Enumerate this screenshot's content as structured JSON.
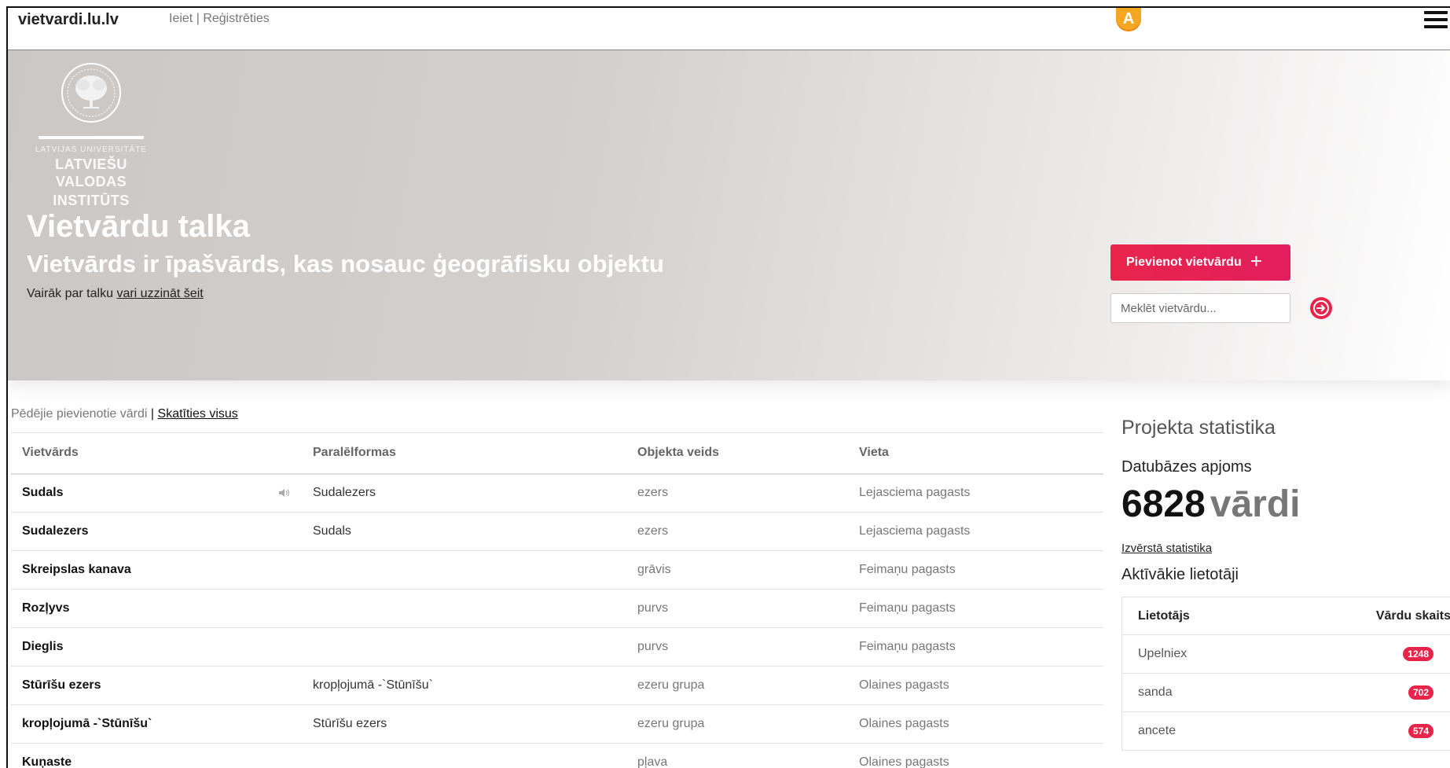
{
  "nav": {
    "brand": "vietvardi.lu.lv",
    "login": "Ieiet",
    "separator": "|",
    "register": "Reģistrēties",
    "avatar_letter": "A",
    "avatar_color": "#f5a623"
  },
  "hero": {
    "logo_small": "LATVIJAS UNIVERSITĀTE",
    "logo_line1": "LATVIEŠU VALODAS",
    "logo_line2": "INSTITŪTS",
    "title": "Vietvārdu talka",
    "subtitle": "Vietvārds ir īpašvārds, kas nosauc ģeogrāfisku objektu",
    "more_text": "Vairāk par talku",
    "more_link": "vari uzzināt šeit",
    "add_button": "Pievienot vietvārdu",
    "add_icon": "plus-icon",
    "search_placeholder": "Meklēt vietvārdu...",
    "accent_color": "#e8244b"
  },
  "recent": {
    "heading": "Pēdējie pievienotie vārdi",
    "separator": "|",
    "view_all": "Skatīties visus",
    "columns": [
      "Vietvārds",
      "Paralēlformas",
      "Objekta veids",
      "Vieta"
    ],
    "rows": [
      {
        "name": "Sudals",
        "parallel": "Sudalezers",
        "type": "ezers",
        "place": "Lejasciema pagasts",
        "audio": true
      },
      {
        "name": "Sudalezers",
        "parallel": "Sudals",
        "type": "ezers",
        "place": "Lejasciema pagasts",
        "audio": false
      },
      {
        "name": "Skreipslas kanava",
        "parallel": "",
        "type": "grāvis",
        "place": "Feimaņu pagasts",
        "audio": false
      },
      {
        "name": "Rozļyvs",
        "parallel": "",
        "type": "purvs",
        "place": "Feimaņu pagasts",
        "audio": false
      },
      {
        "name": "Dieglis",
        "parallel": "",
        "type": "purvs",
        "place": "Feimaņu pagasts",
        "audio": false
      },
      {
        "name": "Stūrīšu ezers",
        "parallel": "kropļojumā -`Stūnīšu`",
        "type": "ezeru grupa",
        "place": "Olaines pagasts",
        "audio": false
      },
      {
        "name": "kropļojumā -`Stūnīšu`",
        "parallel": "Stūrīšu ezers",
        "type": "ezeru grupa",
        "place": "Olaines pagasts",
        "audio": false
      },
      {
        "name": "Kuņaste",
        "parallel": "",
        "type": "pļava",
        "place": "Olaines pagasts",
        "audio": false
      }
    ]
  },
  "stats": {
    "title": "Projekta statistika",
    "db_title": "Datubāzes apjoms",
    "count": "6828",
    "unit": "vārdi",
    "detailed_link": "Izvērstā statistika",
    "active_title": "Aktīvākie lietotāji",
    "user_col": "Lietotājs",
    "count_col": "Vārdu skaits",
    "users": [
      {
        "name": "Upelniex",
        "count": "1248"
      },
      {
        "name": "sanda",
        "count": "702"
      },
      {
        "name": "ancete",
        "count": "574"
      }
    ]
  }
}
